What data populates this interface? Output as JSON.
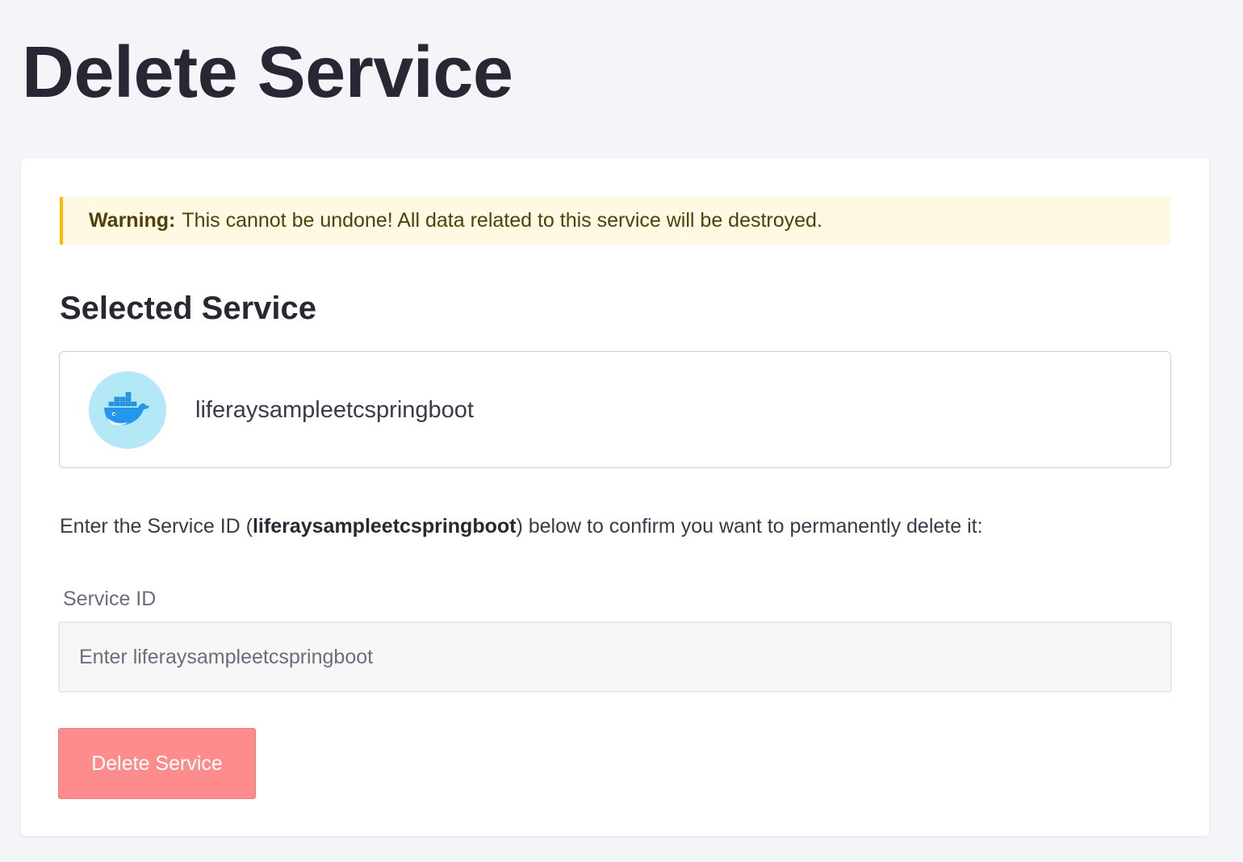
{
  "page": {
    "title": "Delete Service"
  },
  "alert": {
    "lead": "Warning:",
    "message": "This cannot be undone! All data related to this service will be destroyed."
  },
  "selected": {
    "heading": "Selected Service",
    "service_name": "liferaysampleetcspringboot",
    "icon": "docker-whale-icon"
  },
  "confirm": {
    "text_before": "Enter the Service ID (",
    "service_id": "liferaysampleetcspringboot",
    "text_after": ") below to confirm you want to permanently delete it:"
  },
  "form": {
    "label": "Service ID",
    "placeholder": "Enter liferaysampleetcspringboot",
    "value": ""
  },
  "actions": {
    "delete_label": "Delete Service",
    "delete_disabled": true
  },
  "colors": {
    "background": "#f4f5f9",
    "warning_bg": "#fff8e3",
    "warning_border": "#ffb900",
    "danger_disabled": "#ff8c8c",
    "avatar_bg": "#b3e8f6",
    "docker_blue": "#2396ed"
  }
}
